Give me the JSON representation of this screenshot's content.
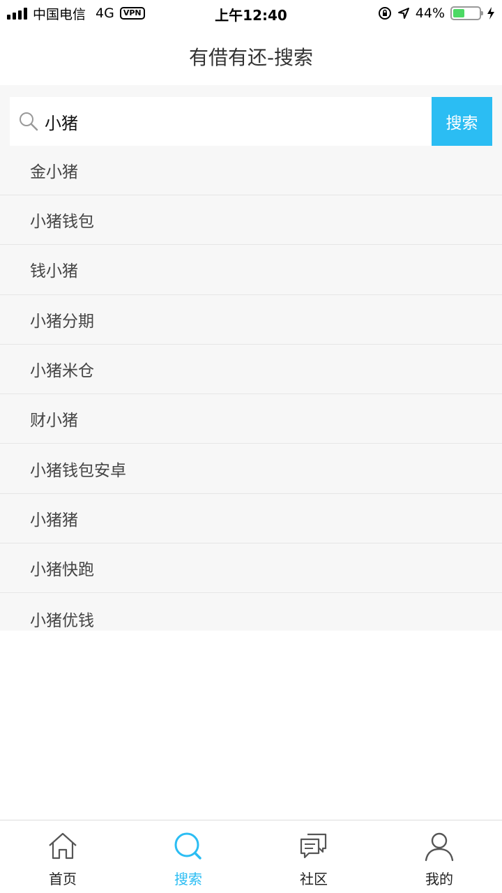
{
  "status_bar": {
    "carrier": "中国电信",
    "network": "4G",
    "vpn": "VPN",
    "time": "上午12:40",
    "battery_text": "44%",
    "battery_level": 0.44
  },
  "header": {
    "title": "有借有还-搜索"
  },
  "search": {
    "value": "小猪",
    "button_label": "搜索"
  },
  "suggestions": [
    "金小猪",
    "小猪钱包",
    "钱小猪",
    "小猪分期",
    "小猪米仓",
    "财小猪",
    "小猪钱包安卓",
    "小猪猪",
    "小猪快跑",
    "小猪优钱"
  ],
  "tabs": [
    {
      "label": "首页",
      "icon": "home-icon",
      "active": false
    },
    {
      "label": "搜索",
      "icon": "search-icon",
      "active": true
    },
    {
      "label": "社区",
      "icon": "chat-icon",
      "active": false
    },
    {
      "label": "我的",
      "icon": "user-icon",
      "active": false
    }
  ],
  "colors": {
    "accent": "#2bbdf3",
    "battery": "#4cd964"
  }
}
